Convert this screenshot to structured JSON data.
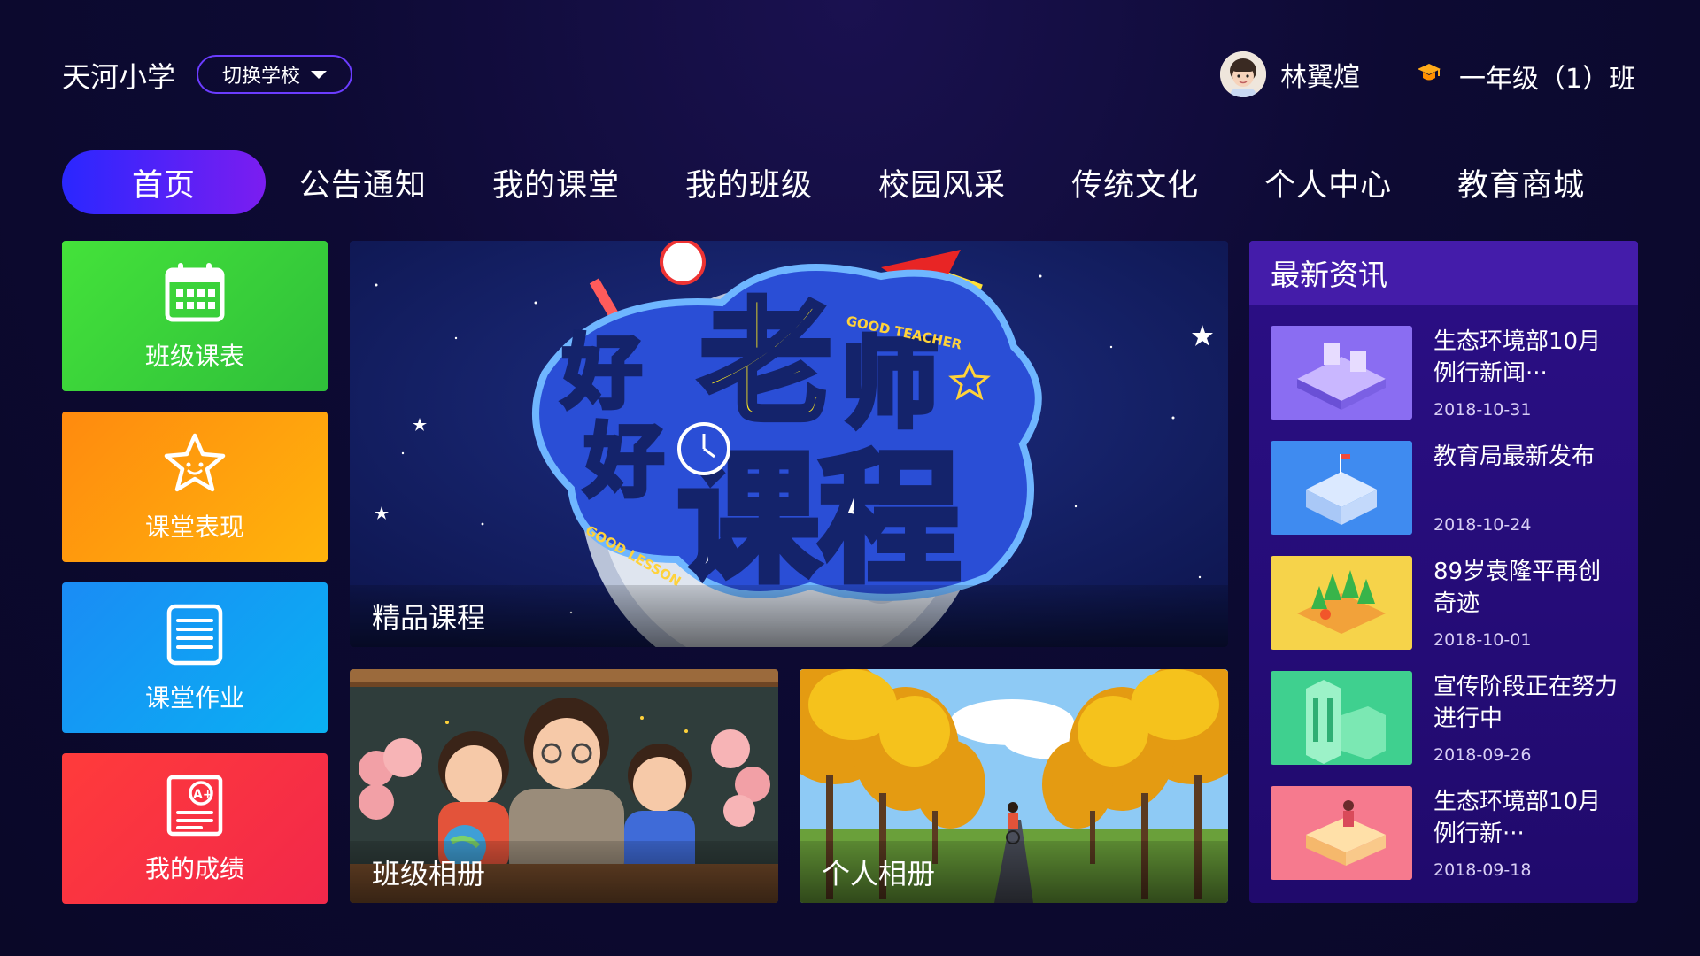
{
  "header": {
    "school_name": "天河小学",
    "switch_school": "切换学校",
    "user_name": "林翼煊",
    "class_name": "一年级（1）班"
  },
  "nav": {
    "items": [
      {
        "label": "首页",
        "active": true
      },
      {
        "label": "公告通知"
      },
      {
        "label": "我的课堂"
      },
      {
        "label": "我的班级"
      },
      {
        "label": "校园风采"
      },
      {
        "label": "传统文化"
      },
      {
        "label": "个人中心"
      },
      {
        "label": "教育商城"
      }
    ]
  },
  "tiles": [
    {
      "label": "班级课表",
      "icon": "calendar-icon",
      "color": "#3dd33a"
    },
    {
      "label": "课堂表现",
      "icon": "star-icon",
      "color": "#ffa20c"
    },
    {
      "label": "课堂作业",
      "icon": "document-list-icon",
      "color": "#139bf7"
    },
    {
      "label": "我的成绩",
      "icon": "grade-report-icon",
      "color": "#ff3c3c"
    }
  ],
  "cards": {
    "featured": {
      "label": "精品课程",
      "banner_text_1": "好老师",
      "banner_text_2": "好课程",
      "banner_en_1": "GOOD TEACHER",
      "banner_en_2": "GOOD LESSON"
    },
    "class_album": {
      "label": "班级相册"
    },
    "personal_album": {
      "label": "个人相册"
    }
  },
  "news": {
    "title": "最新资讯",
    "items": [
      {
        "title": "生态环境部10月例行新闻···",
        "date": "2018-10-31"
      },
      {
        "title": "教育局最新发布",
        "date": "2018-10-24"
      },
      {
        "title": "89岁袁隆平再创奇迹",
        "date": "2018-10-01"
      },
      {
        "title": "宣传阶段正在努力进行中",
        "date": "2018-09-26"
      },
      {
        "title": "生态环境部10月例行新···",
        "date": "2018-09-18"
      }
    ]
  },
  "colors": {
    "background": "#0d0a33",
    "nav_active_start": "#2a27ff",
    "nav_active_end": "#7b1df0",
    "news_panel": "#2b0f86",
    "switch_border": "#6b3cff"
  }
}
